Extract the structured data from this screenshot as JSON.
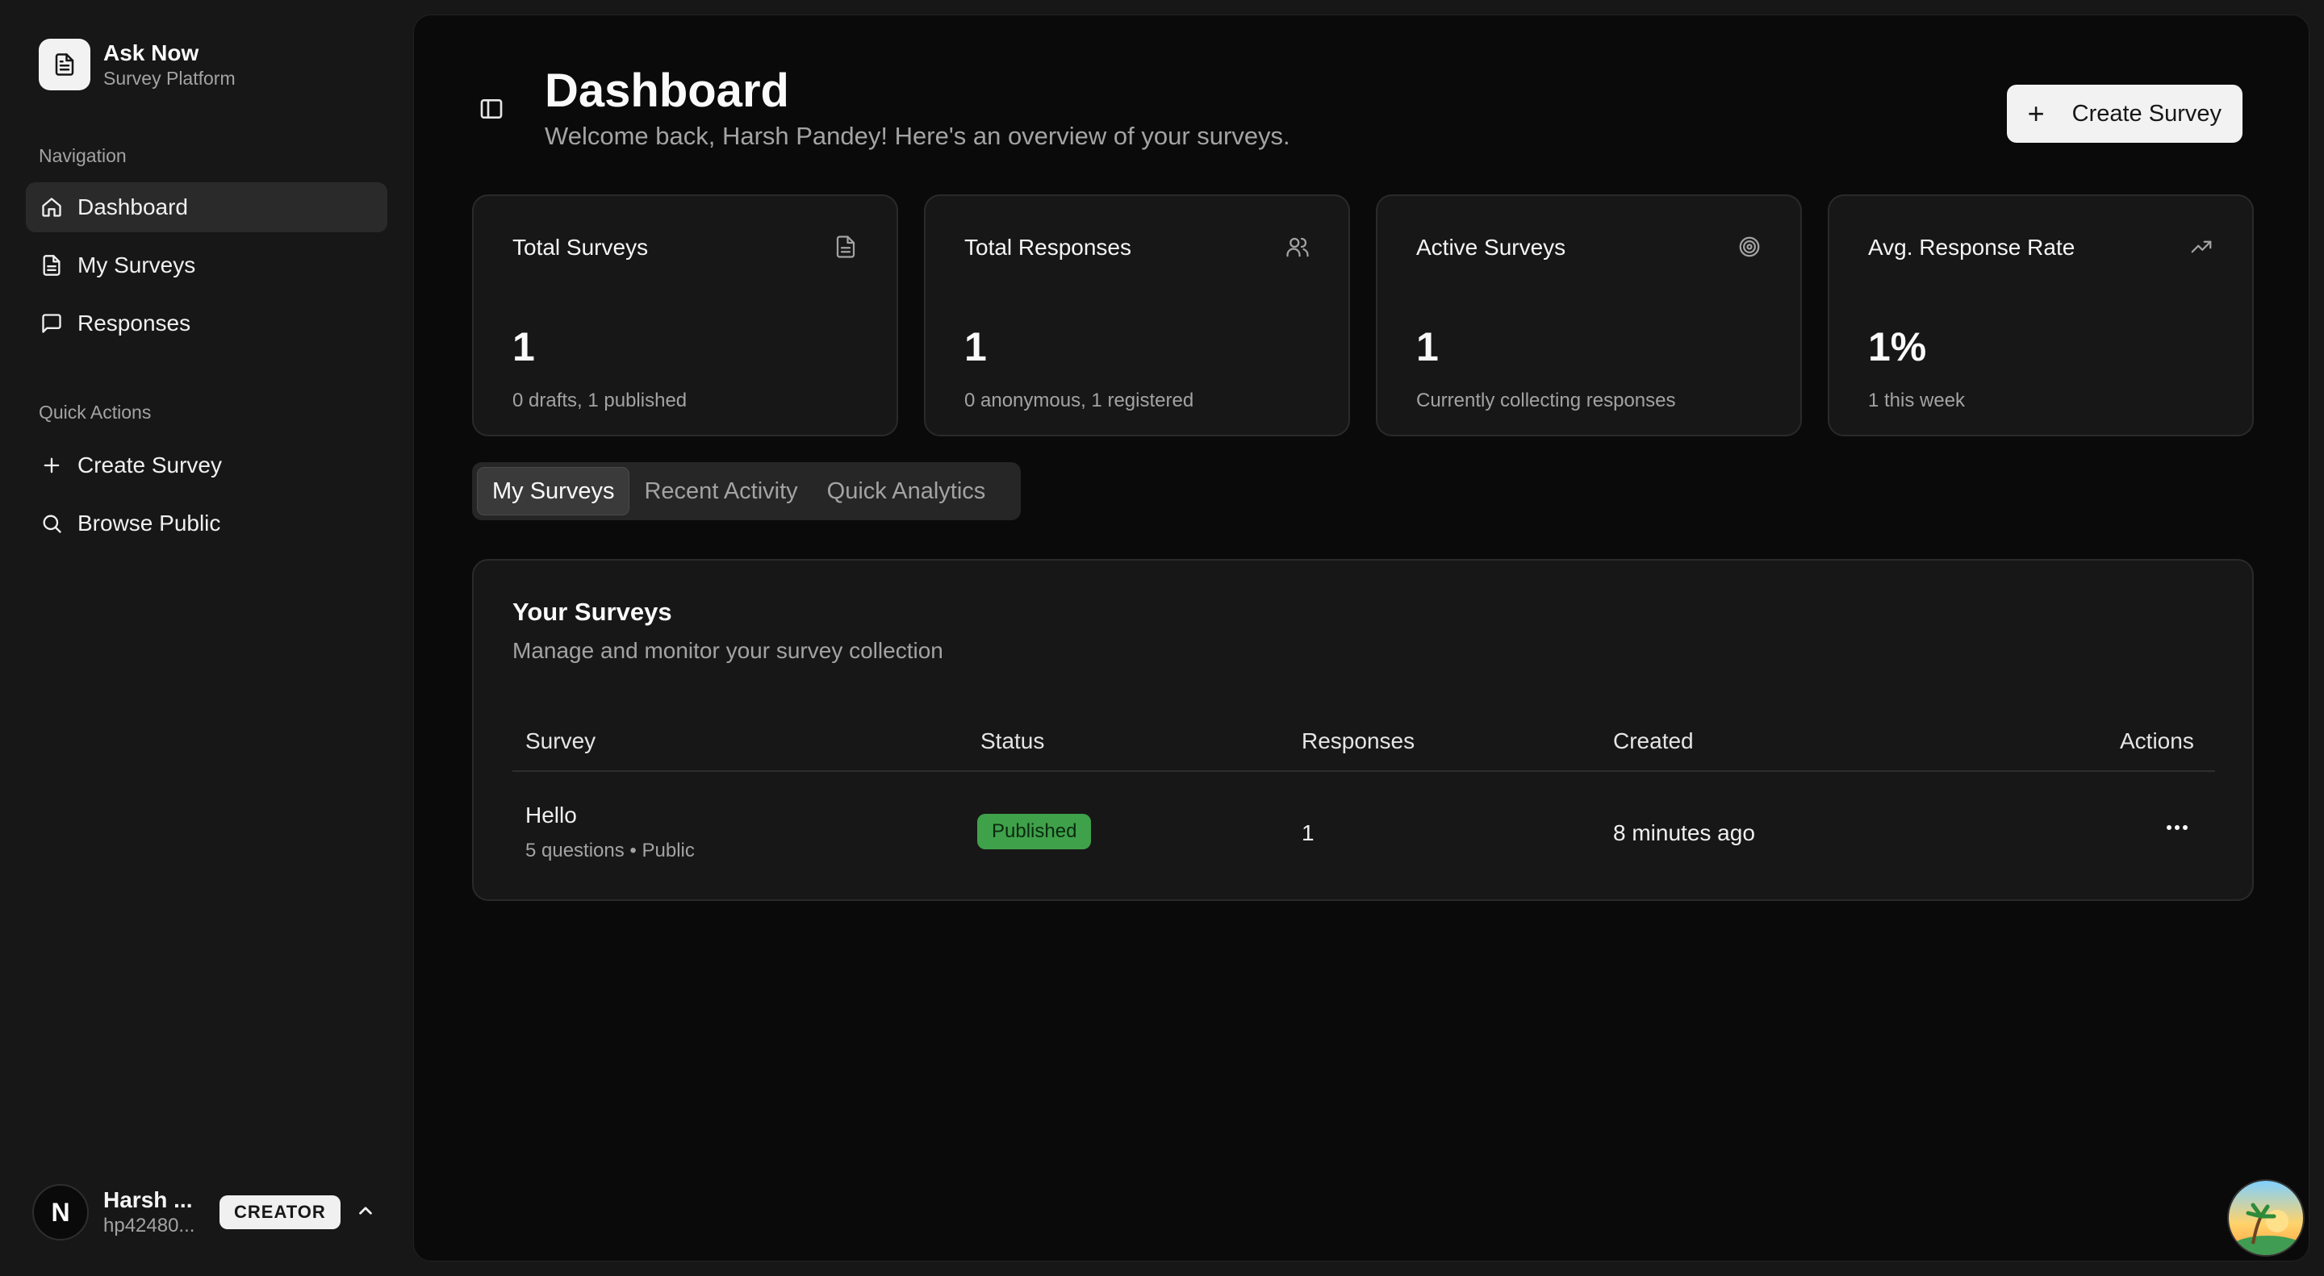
{
  "brand": {
    "name": "Ask Now",
    "subtitle": "Survey Platform"
  },
  "sidebar": {
    "nav_label": "Navigation",
    "nav_items": [
      {
        "label": "Dashboard",
        "icon": "home-icon",
        "active": true
      },
      {
        "label": "My Surveys",
        "icon": "file-icon",
        "active": false
      },
      {
        "label": "Responses",
        "icon": "message-icon",
        "active": false
      }
    ],
    "quick_label": "Quick Actions",
    "quick_items": [
      {
        "label": "Create Survey",
        "icon": "plus-icon"
      },
      {
        "label": "Browse Public",
        "icon": "search-icon"
      }
    ],
    "user": {
      "initial": "N",
      "name": "Harsh ...",
      "email": "hp42480...",
      "role": "CREATOR"
    }
  },
  "header": {
    "title": "Dashboard",
    "subtitle": "Welcome back, Harsh Pandey! Here's an overview of your surveys.",
    "create_label": "Create Survey"
  },
  "stats": [
    {
      "title": "Total Surveys",
      "value": "1",
      "note": "0 drafts, 1 published",
      "icon": "file-icon"
    },
    {
      "title": "Total Responses",
      "value": "1",
      "note": "0 anonymous, 1 registered",
      "icon": "users-icon"
    },
    {
      "title": "Active Surveys",
      "value": "1",
      "note": "Currently collecting responses",
      "icon": "target-icon"
    },
    {
      "title": "Avg. Response Rate",
      "value": "1%",
      "note": "1 this week",
      "icon": "trending-up-icon"
    }
  ],
  "tabs": [
    {
      "label": "My Surveys",
      "active": true
    },
    {
      "label": "Recent Activity",
      "active": false
    },
    {
      "label": "Quick Analytics",
      "active": false
    }
  ],
  "surveys": {
    "title": "Your Surveys",
    "subtitle": "Manage and monitor your survey collection",
    "columns": [
      "Survey",
      "Status",
      "Responses",
      "Created",
      "Actions"
    ],
    "rows": [
      {
        "name": "Hello",
        "meta": "5 questions • Public",
        "status": "Published",
        "responses": "1",
        "created": "8 minutes ago"
      }
    ]
  },
  "colors": {
    "accent": "#f2f2f2",
    "published": "#3fa14a",
    "background": "#0a0a0a",
    "panel": "#171717"
  }
}
